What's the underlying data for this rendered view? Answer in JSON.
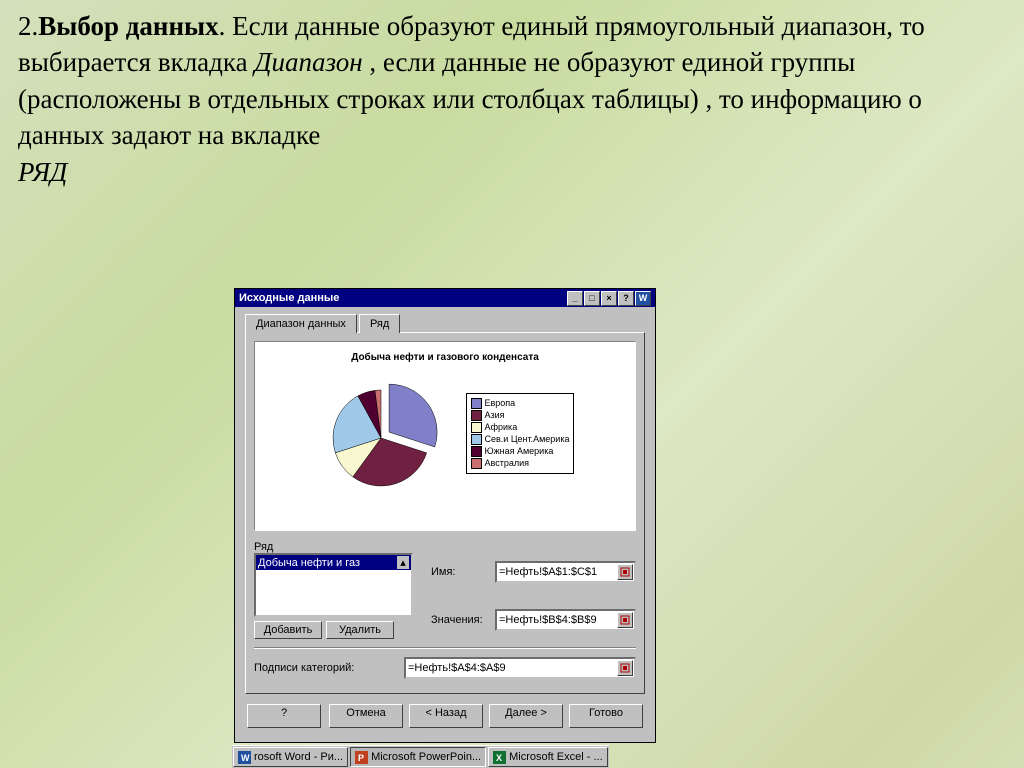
{
  "slide_text": {
    "num": "2.",
    "title": "Выбор данных",
    "body1": ". Если данные образуют единый прямоугольный диапазон, то выбирается вкладка ",
    "italic1": "Диапазон",
    "body2": " , если данные не образуют единой группы (расположены в отдельных строках или столбцах таблицы) , то информацию о данных задают на вкладке ",
    "italic2": "РЯД"
  },
  "dialog": {
    "title": "Исходные данные",
    "tabs": {
      "range": "Диапазон данных",
      "series": "Ряд"
    },
    "chart_title": "Добыча нефти и газового конденсата",
    "series_label": "Ряд",
    "selected_series": "Добыча нефти и газ",
    "name_label": "Имя:",
    "name_value": "=Нефть!$A$1:$C$1",
    "values_label": "Значения:",
    "values_value": "=Нефть!$B$4:$B$9",
    "add_btn": "Добавить",
    "del_btn": "Удалить",
    "catlabels_label": "Подписи категорий:",
    "catlabels_value": "=Нефть!$A$4:$A$9",
    "wiz": {
      "help": "?",
      "cancel": "Отмена",
      "back": "< Назад",
      "next": "Далее >",
      "finish": "Готово"
    }
  },
  "legend": {
    "items": [
      {
        "label": "Европа",
        "color": "#8080c8"
      },
      {
        "label": "Азия",
        "color": "#702040"
      },
      {
        "label": "Африка",
        "color": "#f8f8d0"
      },
      {
        "label": "Сев.и Цент.Америка",
        "color": "#a0c8e8"
      },
      {
        "label": "Южная Америка",
        "color": "#500030"
      },
      {
        "label": "Австралия",
        "color": "#c87070"
      }
    ]
  },
  "chart_data": {
    "type": "pie",
    "title": "Добыча нефти и газового конденсата",
    "categories": [
      "Европа",
      "Азия",
      "Африка",
      "Сев.и Цент.Америка",
      "Южная Америка",
      "Австралия"
    ],
    "values": [
      30,
      30,
      10,
      22,
      6,
      2
    ],
    "colors": [
      "#8080c8",
      "#702040",
      "#f8f8d0",
      "#a0c8e8",
      "#500030",
      "#c87070"
    ],
    "exploded_index": 0
  },
  "taskbar": {
    "word": "rosoft Word - Ри...",
    "ppt": "Microsoft PowerPoin...",
    "excel": "Microsoft Excel - ..."
  }
}
